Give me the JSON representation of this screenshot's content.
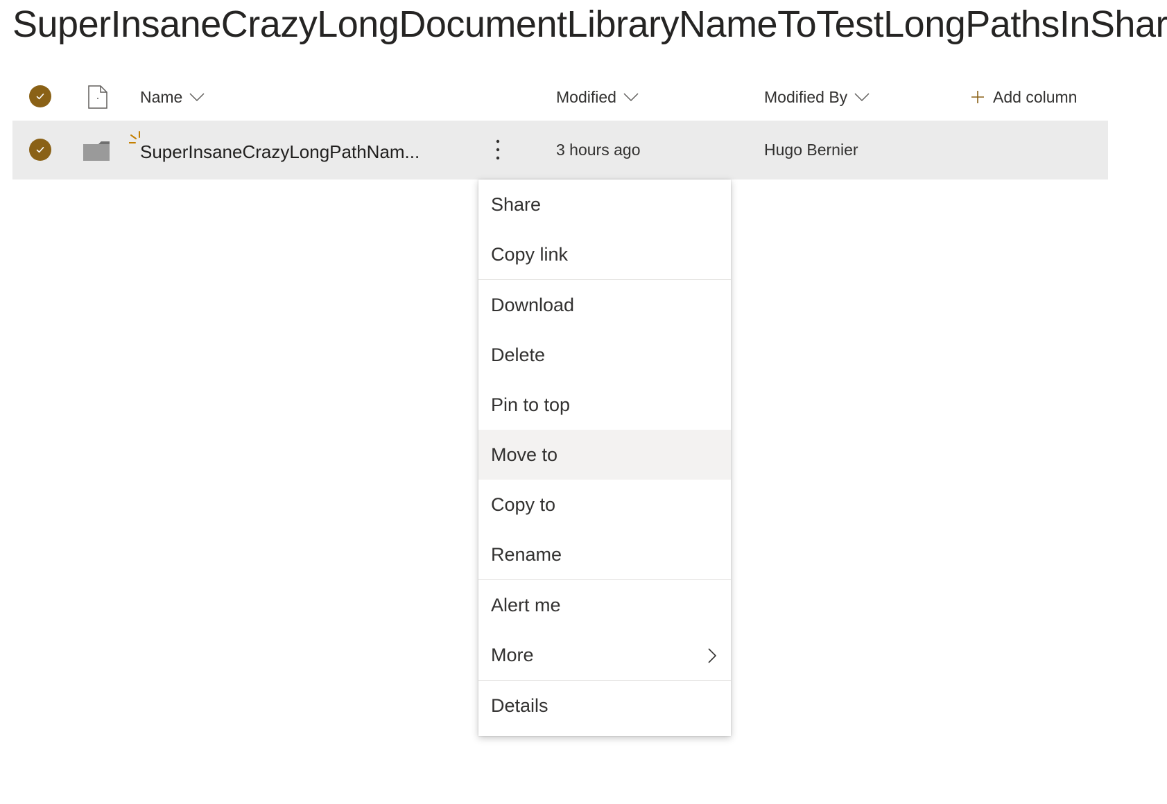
{
  "library": {
    "title": "SuperInsaneCrazyLongDocumentLibraryNameToTestLongPathsInShareP"
  },
  "colors": {
    "accent": "#8a6116",
    "row_selected": "#ebebeb",
    "menu_hover": "#f3f2f1"
  },
  "columns": {
    "name": "Name",
    "modified": "Modified",
    "modified_by": "Modified By",
    "add_column": "Add column"
  },
  "item": {
    "name": "SuperInsaneCrazyLongPathNam...",
    "modified": "3 hours ago",
    "modified_by": "Hugo Bernier",
    "type_icon": "folder-icon",
    "is_new": true,
    "selected": true
  },
  "context_menu": {
    "items": [
      {
        "label": "Share"
      },
      {
        "label": "Copy link"
      },
      {
        "label": "Download"
      },
      {
        "label": "Delete"
      },
      {
        "label": "Pin to top"
      },
      {
        "label": "Move to",
        "highlighted": true
      },
      {
        "label": "Copy to"
      },
      {
        "label": "Rename"
      },
      {
        "label": "Alert me"
      },
      {
        "label": "More",
        "has_submenu": true
      },
      {
        "label": "Details"
      }
    ]
  }
}
